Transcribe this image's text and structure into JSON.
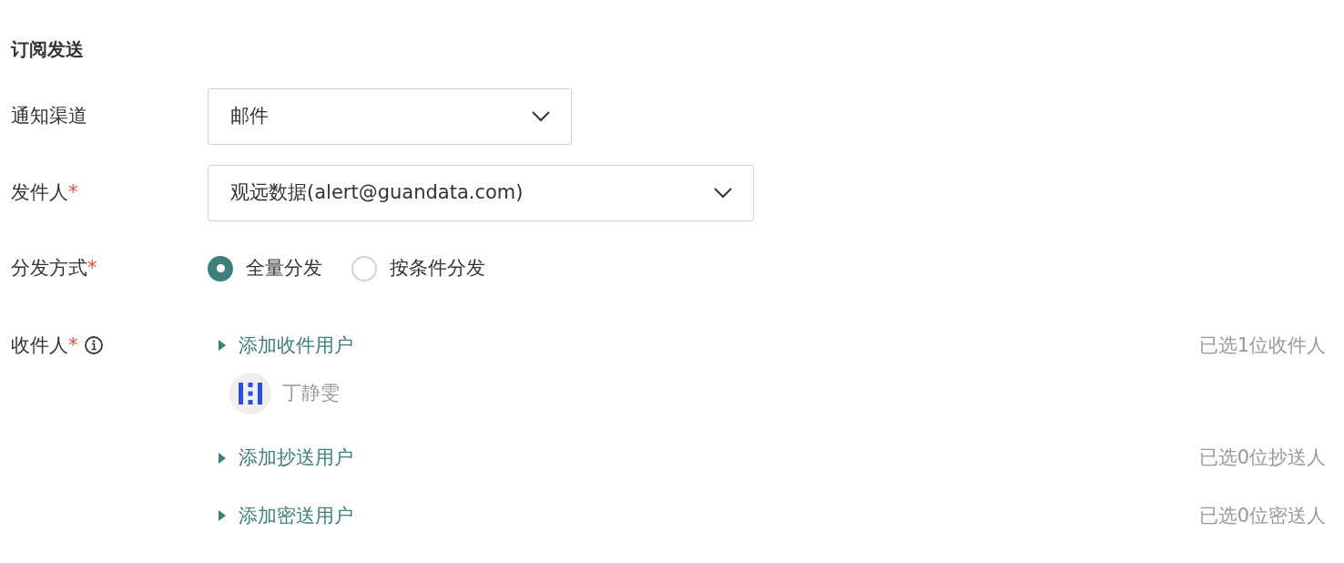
{
  "section_title": "订阅发送",
  "fields": [
    {
      "kind": "select",
      "label": "通知渠道",
      "value": "邮件"
    },
    {
      "kind": "select",
      "label": "发件人",
      "required_mark": "*",
      "value": "观远数据(alert@guandata.com)"
    },
    {
      "kind": "radio",
      "label": "分发方式",
      "required_mark": "*",
      "options": [
        {
          "label": "全量分发",
          "selected": true
        },
        {
          "label": "按条件分发",
          "selected": false
        }
      ]
    },
    {
      "kind": "recipients",
      "label": "收件人",
      "required_mark": "*",
      "info": true,
      "groups": [
        {
          "link": "添加收件用户",
          "summary": "已选1位收件人",
          "users": [
            {
              "name": "丁静雯"
            }
          ]
        },
        {
          "link": "添加抄送用户",
          "summary": "已选0位抄送人"
        },
        {
          "link": "添加密送用户",
          "summary": "已选0位密送人"
        }
      ]
    }
  ]
}
